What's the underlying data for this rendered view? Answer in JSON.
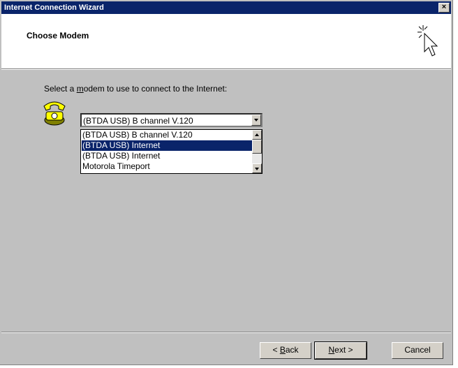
{
  "window": {
    "title": "Internet Connection Wizard",
    "close_glyph": "×"
  },
  "header": {
    "title": "Choose Modem",
    "icon": "cursor-sparkle-icon"
  },
  "content": {
    "prompt_pre": "Select a ",
    "prompt_key": "m",
    "prompt_post": "odem to use to connect to the Internet:",
    "icon": "phone-icon",
    "combo_value": "(BTDA USB) B channel V.120",
    "list_items": [
      {
        "label": "(BTDA USB) B channel V.120",
        "selected": false
      },
      {
        "label": "(BTDA USB) Internet",
        "selected": true
      },
      {
        "label": "(BTDA USB) Internet",
        "selected": false
      },
      {
        "label": "Motorola Timeport",
        "selected": false
      }
    ]
  },
  "buttons": {
    "back_pre": "< ",
    "back_key": "B",
    "back_post": "ack",
    "next_key": "N",
    "next_post": "ext >",
    "cancel": "Cancel"
  }
}
